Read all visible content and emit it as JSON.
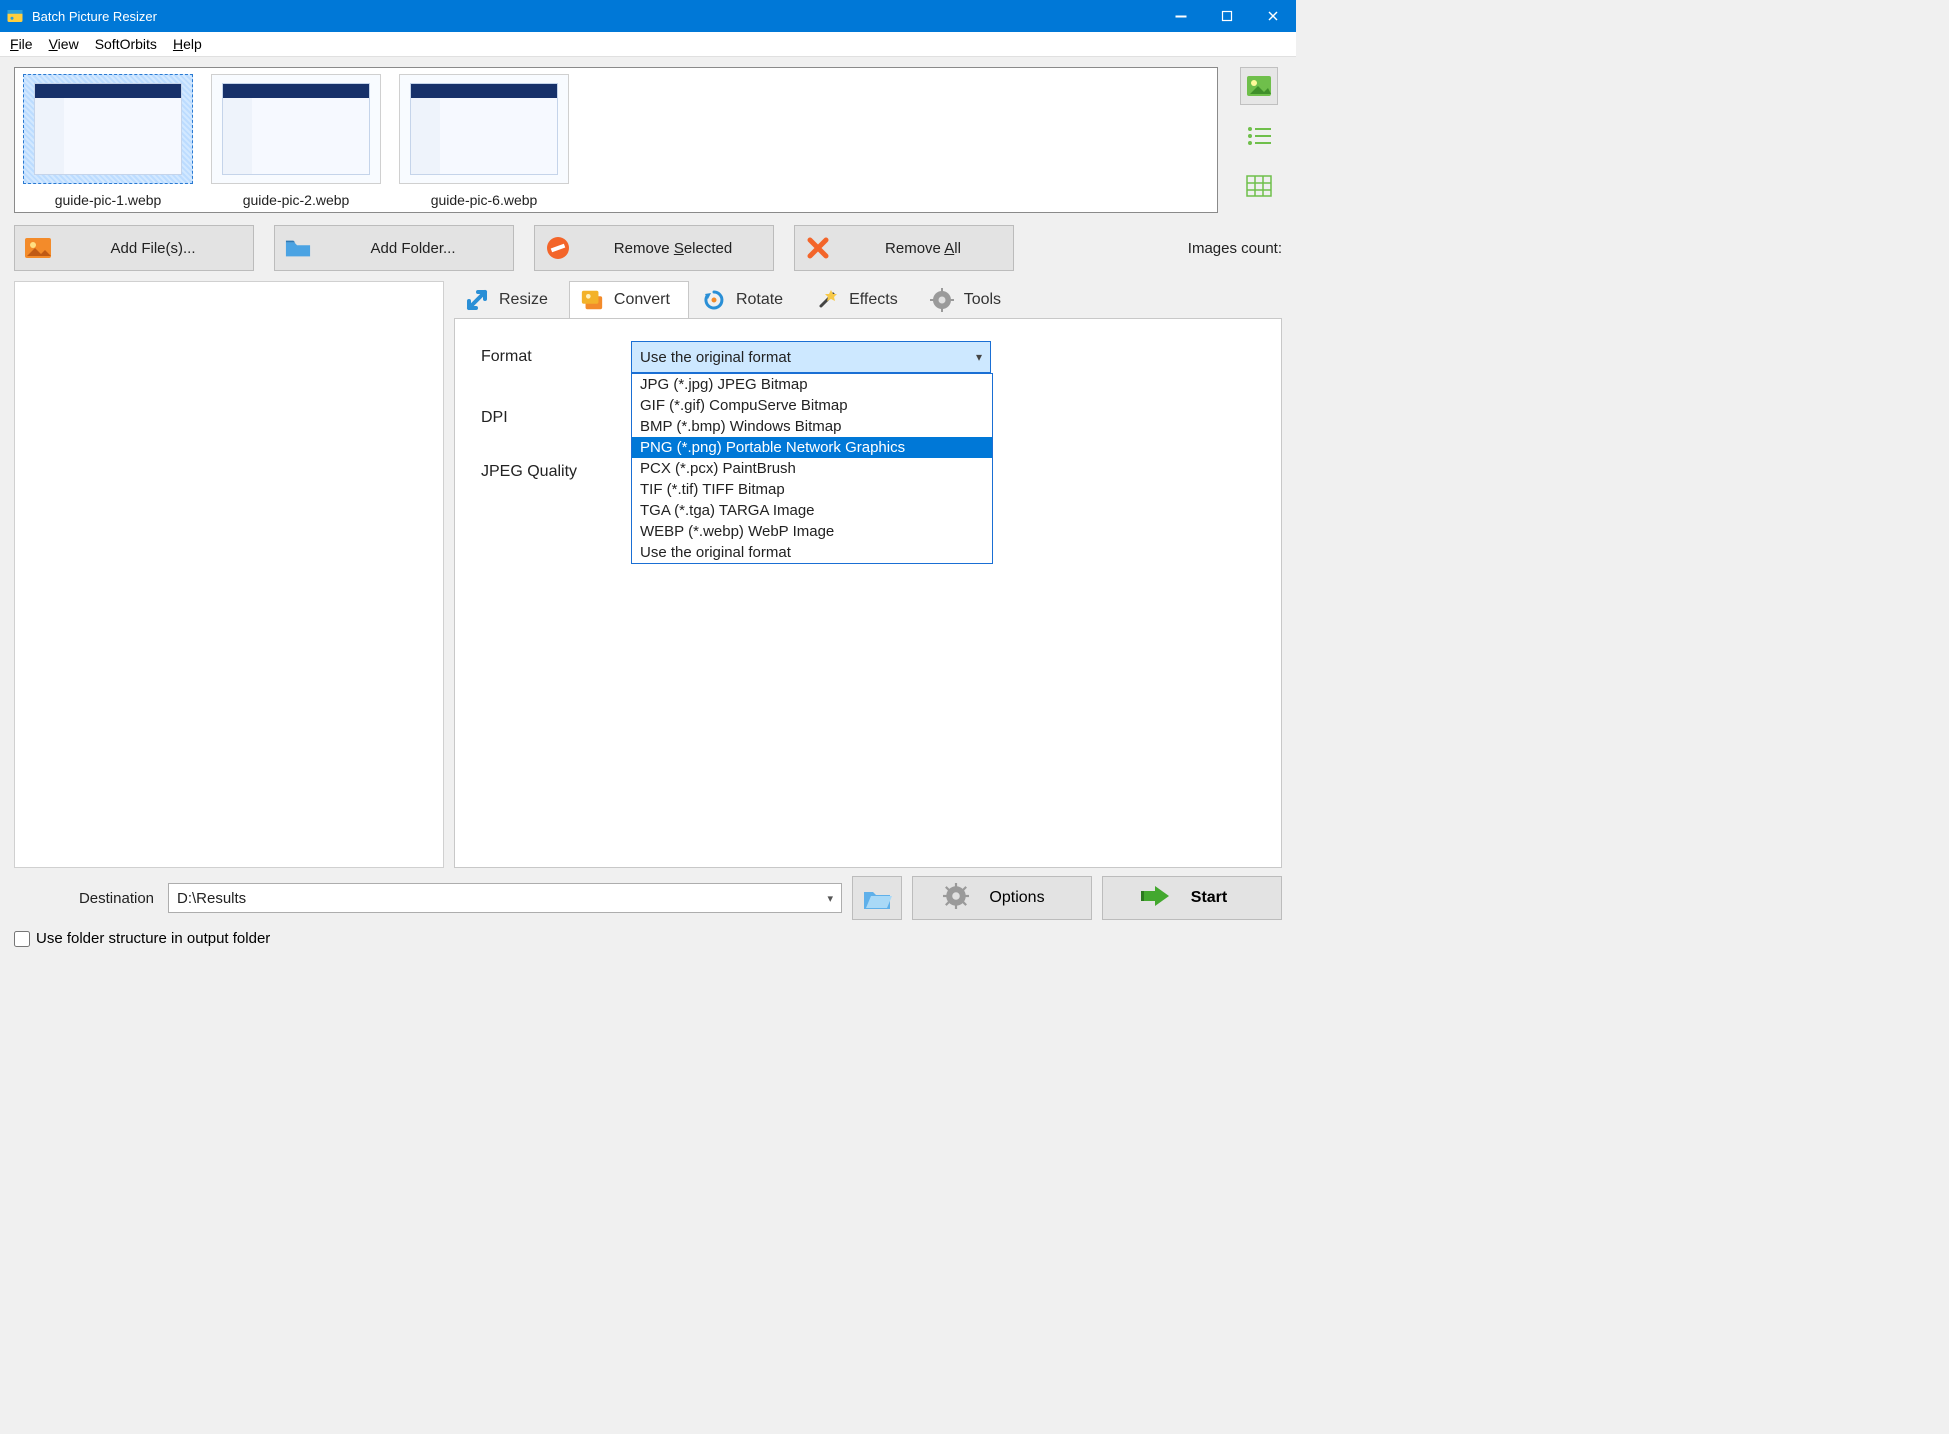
{
  "window": {
    "title": "Batch Picture Resizer"
  },
  "menu": {
    "file": "File",
    "view": "View",
    "softorbits": "SoftOrbits",
    "help": "Help"
  },
  "thumbs": {
    "item1": "guide-pic-1.webp",
    "item2": "guide-pic-2.webp",
    "item3": "guide-pic-6.webp"
  },
  "toolbar": {
    "add_files": "Add File(s)...",
    "add_folder": "Add Folder...",
    "remove_selected": "Remove Selected",
    "remove_all": "Remove All",
    "images_count_label": "Images count:"
  },
  "tabs": {
    "resize": "Resize",
    "convert": "Convert",
    "rotate": "Rotate",
    "effects": "Effects",
    "tools": "Tools"
  },
  "convert_panel": {
    "format_label": "Format",
    "dpi_label": "DPI",
    "jpeg_quality_label": "JPEG Quality",
    "selected_format": "Use the original format",
    "options": {
      "jpg": "JPG (*.jpg) JPEG Bitmap",
      "gif": "GIF (*.gif) CompuServe Bitmap",
      "bmp": "BMP (*.bmp) Windows Bitmap",
      "png": "PNG (*.png) Portable Network Graphics",
      "pcx": "PCX (*.pcx) PaintBrush",
      "tif": "TIF (*.tif) TIFF Bitmap",
      "tga": "TGA (*.tga) TARGA Image",
      "webp": "WEBP (*.webp) WebP Image",
      "orig": "Use the original format"
    }
  },
  "destination": {
    "label": "Destination",
    "value": "D:\\Results",
    "use_folder_structure": "Use folder structure in output folder"
  },
  "buttons": {
    "options": "Options",
    "start": "Start"
  }
}
